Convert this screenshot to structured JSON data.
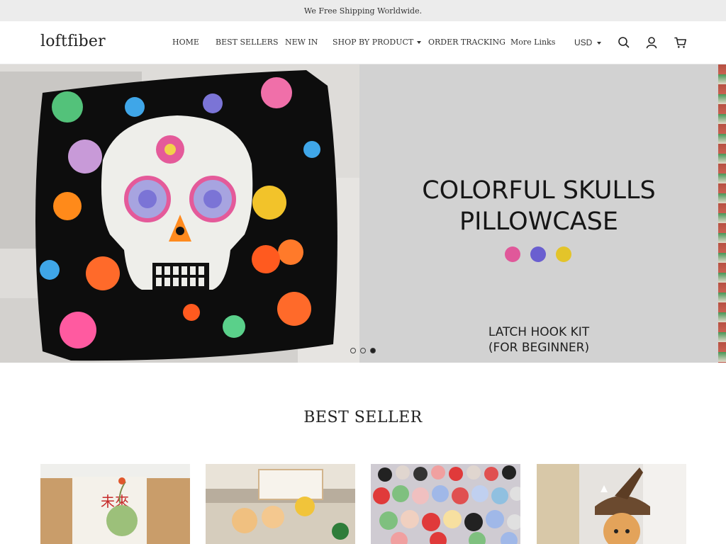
{
  "announcement": "We Free Shipping Worldwide.",
  "header": {
    "logo": "loftfiber",
    "nav": [
      {
        "label": "HOME",
        "has_dropdown": false
      },
      {
        "label": "BEST SELLERS",
        "has_dropdown": false
      },
      {
        "label": "NEW IN",
        "has_dropdown": false
      },
      {
        "label": "SHOP BY PRODUCT",
        "has_dropdown": true
      },
      {
        "label": "ORDER TRACKING",
        "has_dropdown": false
      },
      {
        "label": "More Links",
        "has_dropdown": false
      }
    ],
    "currency": "USD",
    "icons": [
      "search-icon",
      "account-icon",
      "cart-icon"
    ]
  },
  "hero": {
    "title_lines": [
      "COLORFUL SKULLS",
      "PILLOWCASE"
    ],
    "color_dots": [
      "#e0589a",
      "#6a5fd0",
      "#e3c42a"
    ],
    "subtitle_lines": [
      "LATCH HOOK KIT",
      "(FOR BEGINNER)"
    ],
    "slides": 3,
    "active_slide": 3
  },
  "best_seller": {
    "title": "BEST SELLER",
    "products": [
      {
        "name": "product-image-1"
      },
      {
        "name": "product-image-2"
      },
      {
        "name": "product-image-3"
      },
      {
        "name": "product-image-4"
      }
    ]
  },
  "colors": {
    "announcement_bg": "#ececec",
    "hero_bg": "#d2d2d2",
    "text": "#1f1f1f"
  }
}
